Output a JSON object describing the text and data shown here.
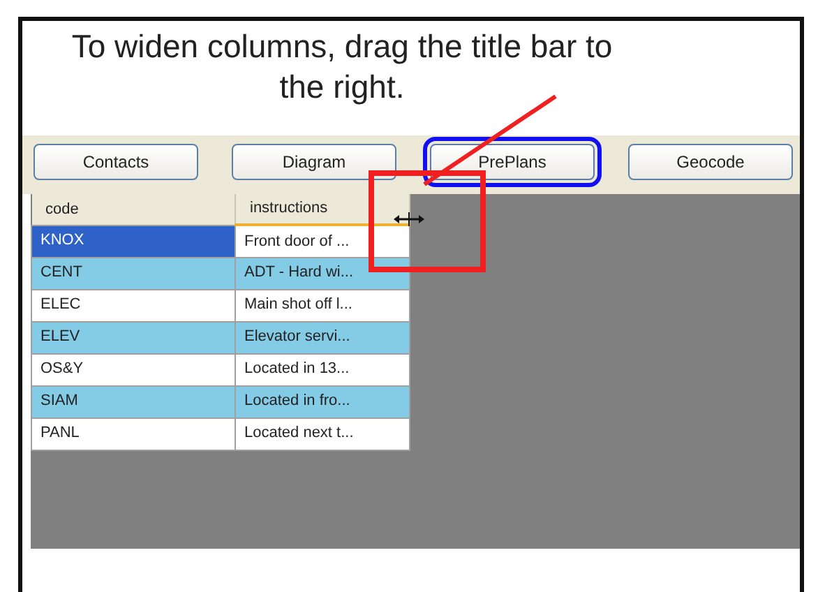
{
  "caption": "To widen columns, drag the title bar to the right.",
  "buttons": [
    {
      "label": "Contacts",
      "highlighted": false
    },
    {
      "label": "Diagram",
      "highlighted": false
    },
    {
      "label": "PrePlans",
      "highlighted": true
    },
    {
      "label": "Geocode",
      "highlighted": false
    }
  ],
  "table": {
    "columns": [
      "code",
      "instructions"
    ],
    "rows": [
      {
        "code": "KNOX",
        "instructions": "Front door of ...",
        "selected": true,
        "shaded": false
      },
      {
        "code": "CENT",
        "instructions": "ADT - Hard wi...",
        "selected": false,
        "shaded": true
      },
      {
        "code": "ELEC",
        "instructions": "Main shot off l...",
        "selected": false,
        "shaded": false
      },
      {
        "code": "ELEV",
        "instructions": "Elevator servi...",
        "selected": false,
        "shaded": true
      },
      {
        "code": "OS&Y",
        "instructions": "Located in 13...",
        "selected": false,
        "shaded": false
      },
      {
        "code": "SIAM",
        "instructions": "Located in fro...",
        "selected": false,
        "shaded": true
      },
      {
        "code": "PANL",
        "instructions": "Located next t...",
        "selected": false,
        "shaded": false
      }
    ]
  }
}
